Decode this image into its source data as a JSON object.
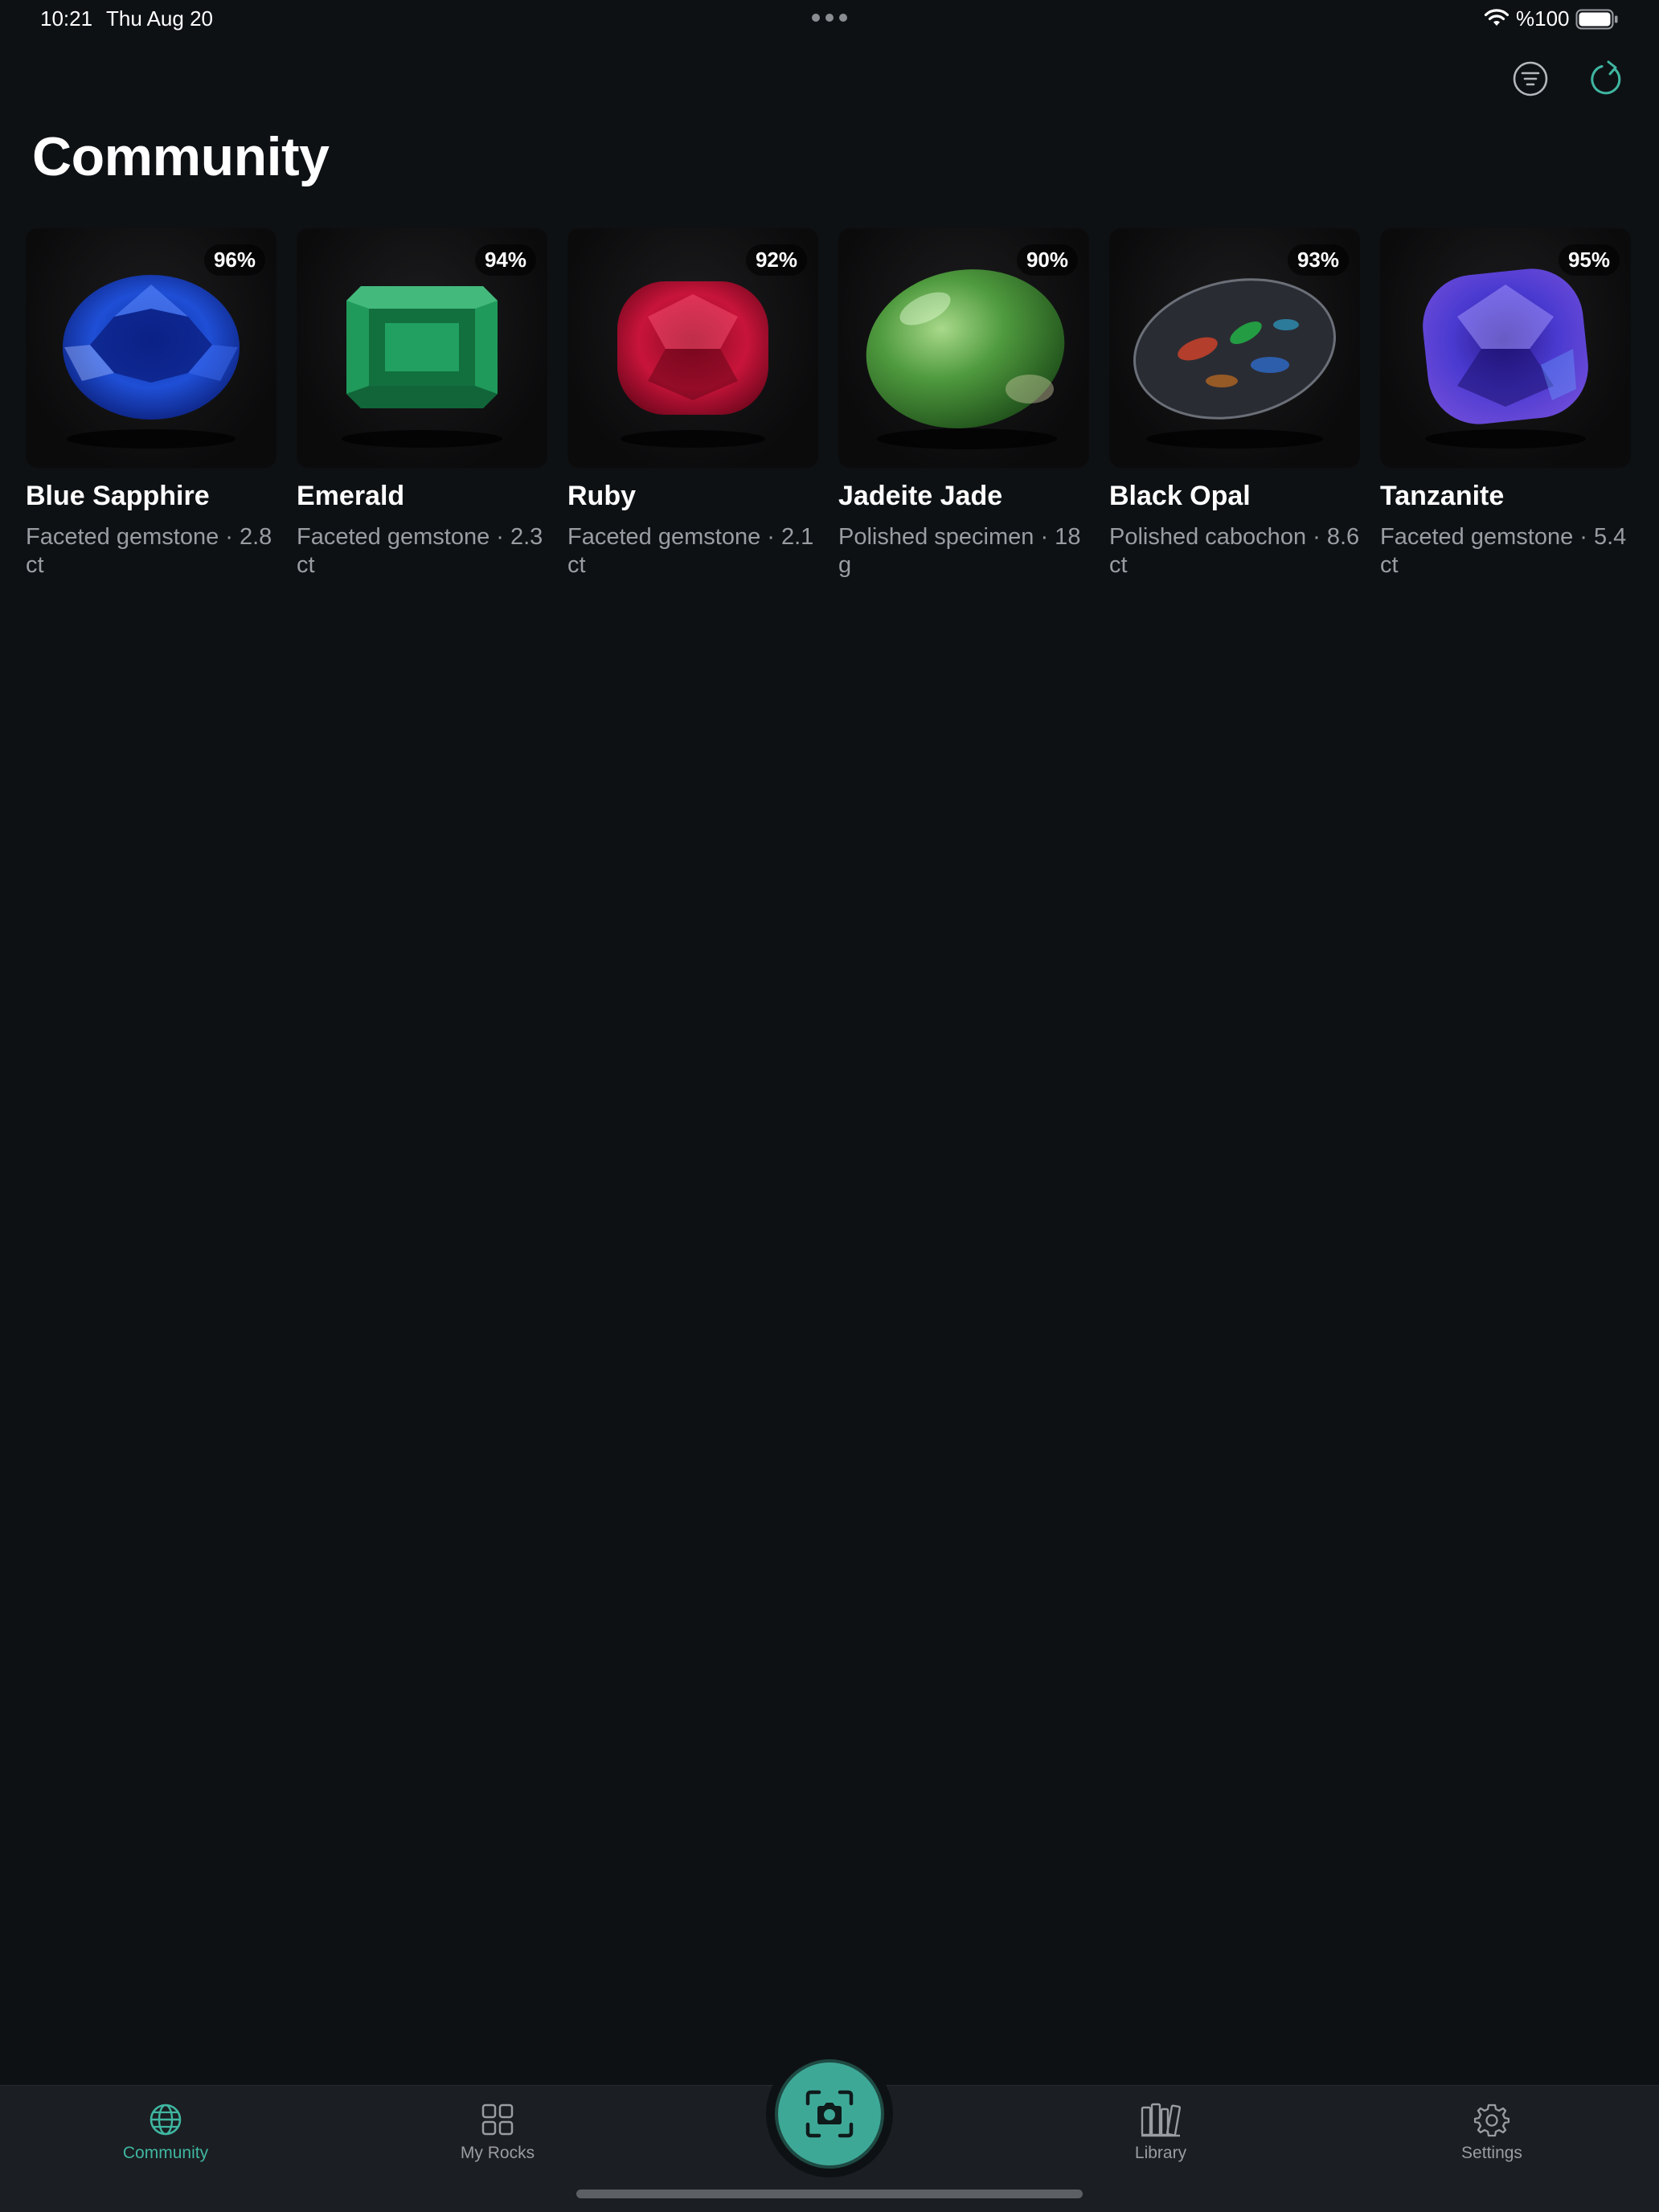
{
  "status_bar": {
    "time": "10:21",
    "date": "Thu Aug 20",
    "battery_text": "%100"
  },
  "page": {
    "title": "Community"
  },
  "actions": {
    "filter_icon": "filter-icon",
    "refresh_icon": "refresh-icon"
  },
  "cards": [
    {
      "name": "Blue Sapphire",
      "description": "Faceted gemstone · 2.8 ct",
      "confidence": "96%",
      "color": "#1f4fd6"
    },
    {
      "name": "Emerald",
      "description": "Faceted gemstone · 2.3 ct",
      "confidence": "94%",
      "color": "#1f9a5a"
    },
    {
      "name": "Ruby",
      "description": "Faceted gemstone · 2.1 ct",
      "confidence": "92%",
      "color": "#c8143a"
    },
    {
      "name": "Jadeite Jade",
      "description": "Polished specimen · 18 g",
      "confidence": "90%",
      "color": "#4f9a3e"
    },
    {
      "name": "Black Opal",
      "description": "Polished cabochon · 8.6 ct",
      "confidence": "93%",
      "color": "#2a2c33"
    },
    {
      "name": "Tanzanite",
      "description": "Faceted gemstone · 5.4 ct",
      "confidence": "95%",
      "color": "#4a3ad0"
    }
  ],
  "tab_bar": {
    "tabs": [
      {
        "label": "Community",
        "icon": "globe-icon",
        "active": true
      },
      {
        "label": "My Rocks",
        "icon": "grid-icon",
        "active": false
      },
      {
        "label": "Library",
        "icon": "books-icon",
        "active": false
      },
      {
        "label": "Settings",
        "icon": "gear-icon",
        "active": false
      }
    ],
    "scan_icon": "camera-scan-icon"
  },
  "colors": {
    "accent": "#3fb6a1",
    "background": "#0e1114",
    "tab_bar_background": "#1b1e22",
    "secondary_text": "#9a9da2"
  }
}
